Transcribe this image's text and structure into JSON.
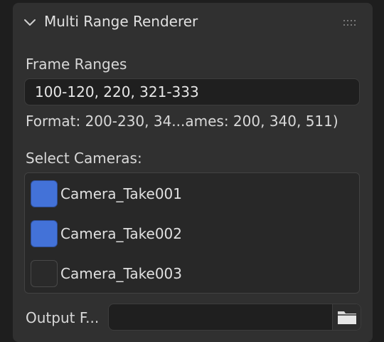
{
  "panel": {
    "title": "Multi Range Renderer",
    "collapse_icon": "chevron-down-icon",
    "drag_icon": "drag-handle-icon"
  },
  "frame_ranges": {
    "label": "Frame Ranges",
    "value": "100-120, 220, 321-333",
    "hint": "Format: 200-230, 34...ames: 200, 340, 511)"
  },
  "cameras": {
    "label": "Select Cameras:",
    "items": [
      {
        "name": "Camera_Take001",
        "checked": true
      },
      {
        "name": "Camera_Take002",
        "checked": true
      },
      {
        "name": "Camera_Take003",
        "checked": false
      }
    ]
  },
  "output": {
    "label": "Output F...",
    "value": "",
    "browse_icon": "folder-icon"
  },
  "colors": {
    "accent": "#4372d8",
    "panel_bg": "#303030",
    "field_bg": "#1f1f1f"
  }
}
